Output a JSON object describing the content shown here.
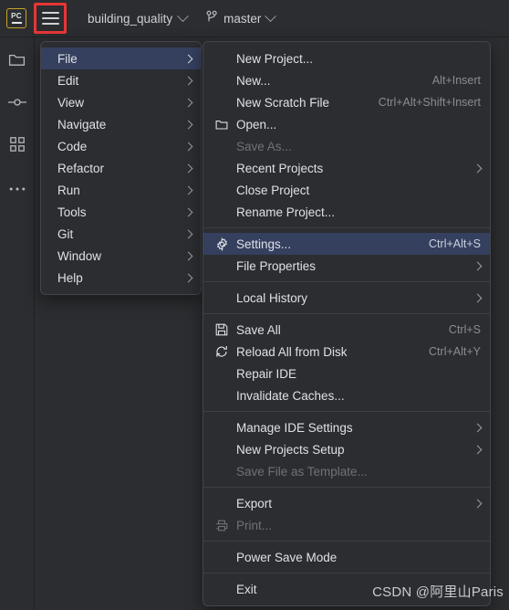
{
  "toolbar": {
    "logo_text": "PC",
    "project_name": "building_quality",
    "branch_name": "master",
    "project_chevron_icon": "chevron-down-icon",
    "branch_chevron_icon": "chevron-down-icon",
    "branch_icon": "git-branch-icon",
    "hamburger_label": "Main Menu",
    "highlight_color": "#e83636"
  },
  "rail": {
    "items": [
      {
        "icon": "folder-icon",
        "name": "project-tool-window"
      },
      {
        "icon": "commit-icon",
        "name": "commit-tool-window"
      },
      {
        "icon": "structure-icon",
        "name": "structure-tool-window"
      },
      {
        "icon": "more-icon",
        "name": "more-tool-windows"
      }
    ]
  },
  "main_menu": {
    "selected": "File",
    "items": [
      {
        "label": "File",
        "arrow": true,
        "selected": true
      },
      {
        "label": "Edit",
        "arrow": true
      },
      {
        "label": "View",
        "arrow": true
      },
      {
        "label": "Navigate",
        "arrow": true
      },
      {
        "label": "Code",
        "arrow": true
      },
      {
        "label": "Refactor",
        "arrow": true
      },
      {
        "label": "Run",
        "arrow": true
      },
      {
        "label": "Tools",
        "arrow": true
      },
      {
        "label": "Git",
        "arrow": true
      },
      {
        "label": "Window",
        "arrow": true
      },
      {
        "label": "Help",
        "arrow": true
      }
    ]
  },
  "file_menu": {
    "groups": [
      {
        "items": [
          {
            "label": "New Project...",
            "shortcut": ""
          },
          {
            "label": "New...",
            "shortcut": "Alt+Insert"
          },
          {
            "label": "New Scratch File",
            "shortcut": "Ctrl+Alt+Shift+Insert"
          },
          {
            "label": "Open...",
            "shortcut": "",
            "icon": "folder-icon"
          },
          {
            "label": "Save As...",
            "shortcut": "",
            "disabled": true
          },
          {
            "label": "Recent Projects",
            "shortcut": "",
            "arrow": true
          },
          {
            "label": "Close Project",
            "shortcut": ""
          },
          {
            "label": "Rename Project...",
            "shortcut": ""
          }
        ]
      },
      {
        "items": [
          {
            "label": "Settings...",
            "shortcut": "Ctrl+Alt+S",
            "icon": "gear-icon",
            "selected": true
          },
          {
            "label": "File Properties",
            "shortcut": "",
            "arrow": true
          }
        ]
      },
      {
        "items": [
          {
            "label": "Local History",
            "shortcut": "",
            "arrow": true
          }
        ]
      },
      {
        "items": [
          {
            "label": "Save All",
            "shortcut": "Ctrl+S",
            "icon": "save-icon"
          },
          {
            "label": "Reload All from Disk",
            "shortcut": "Ctrl+Alt+Y",
            "icon": "refresh-icon"
          },
          {
            "label": "Repair IDE",
            "shortcut": ""
          },
          {
            "label": "Invalidate Caches...",
            "shortcut": ""
          }
        ]
      },
      {
        "items": [
          {
            "label": "Manage IDE Settings",
            "shortcut": "",
            "arrow": true
          },
          {
            "label": "New Projects Setup",
            "shortcut": "",
            "arrow": true
          },
          {
            "label": "Save File as Template...",
            "shortcut": "",
            "disabled": true
          }
        ]
      },
      {
        "items": [
          {
            "label": "Export",
            "shortcut": "",
            "arrow": true
          },
          {
            "label": "Print...",
            "shortcut": "",
            "icon": "print-icon",
            "disabled": true
          }
        ]
      },
      {
        "items": [
          {
            "label": "Power Save Mode",
            "shortcut": ""
          }
        ]
      },
      {
        "items": [
          {
            "label": "Exit",
            "shortcut": ""
          }
        ]
      }
    ]
  },
  "watermark": {
    "text": "CSDN @阿里山Paris"
  },
  "colors": {
    "background": "#2b2d30",
    "menu_background": "#2b2d30",
    "selection": "#35405f",
    "text": "#dfe1e5",
    "disabled_text": "#6f7276",
    "shortcut_text": "#8a8d91",
    "separator": "#3c3f43",
    "annotation": "#e83636",
    "logo_border": "#c9a227"
  }
}
